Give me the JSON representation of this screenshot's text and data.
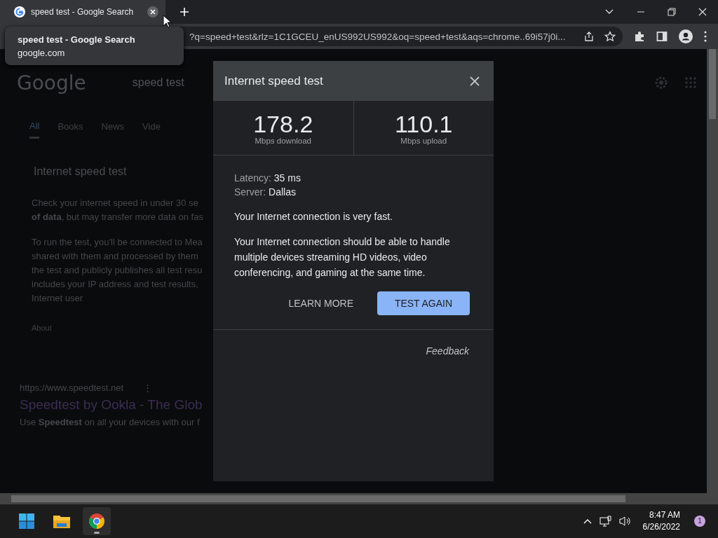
{
  "browser": {
    "tabs": [
      {
        "title": "speed test - Google Search",
        "selected": true
      }
    ],
    "hover_card": {
      "title": "speed test - Google Search",
      "domain": "google.com"
    },
    "address": "?q=speed+test&rlz=1C1GCEU_enUS992US992&oq=speed+test&aqs=chrome..69i57j0i..."
  },
  "page": {
    "logo": "Google",
    "search": "speed test",
    "tabs": [
      {
        "label": "All",
        "selected": true
      },
      {
        "label": "Books",
        "selected": false
      },
      {
        "label": "News",
        "selected": false
      },
      {
        "label": "Vide",
        "selected": false
      }
    ],
    "card_title": "Internet speed test",
    "para1": [
      "Check your internet speed in under 30 se",
      "**of data**, but may transfer more data on fas"
    ],
    "para2": [
      "To run the test, you'll be connected to Mea",
      "shared with them and processed by them",
      "the test and publicly publishes all test resu",
      "includes your IP address and test results,",
      "Internet user"
    ],
    "about": "About",
    "result": {
      "url": "https://www.speedtest.net",
      "more": "⋮",
      "title": "Speedtest by Ookla - The Glob",
      "snippet": "Use **Speedtest** on all your devices with our f"
    }
  },
  "dialog": {
    "title": "Internet speed test",
    "stats": [
      {
        "value": "178.2",
        "unit": "Mbps download"
      },
      {
        "value": "110.1",
        "unit": "Mbps upload"
      }
    ],
    "details": [
      {
        "label": "Latency:",
        "value": "35 ms"
      },
      {
        "label": "Server:",
        "value": "Dallas"
      }
    ],
    "verdict": "Your Internet connection is very fast.",
    "explanation": "Your Internet connection should be able to handle multiple devices streaming HD videos, video conferencing, and gaming at the same time.",
    "buttons": [
      {
        "label": "LEARN MORE",
        "kind": "text"
      },
      {
        "label": "TEST AGAIN",
        "kind": "filled"
      }
    ],
    "feedback": "Feedback"
  },
  "taskbar": {
    "apps": [
      {
        "kind": "start",
        "active": false
      },
      {
        "kind": "folder",
        "active": false
      },
      {
        "kind": "browser",
        "active": true
      }
    ],
    "time": "8:47 AM",
    "date": "6/26/2022",
    "notifications": "1"
  }
}
